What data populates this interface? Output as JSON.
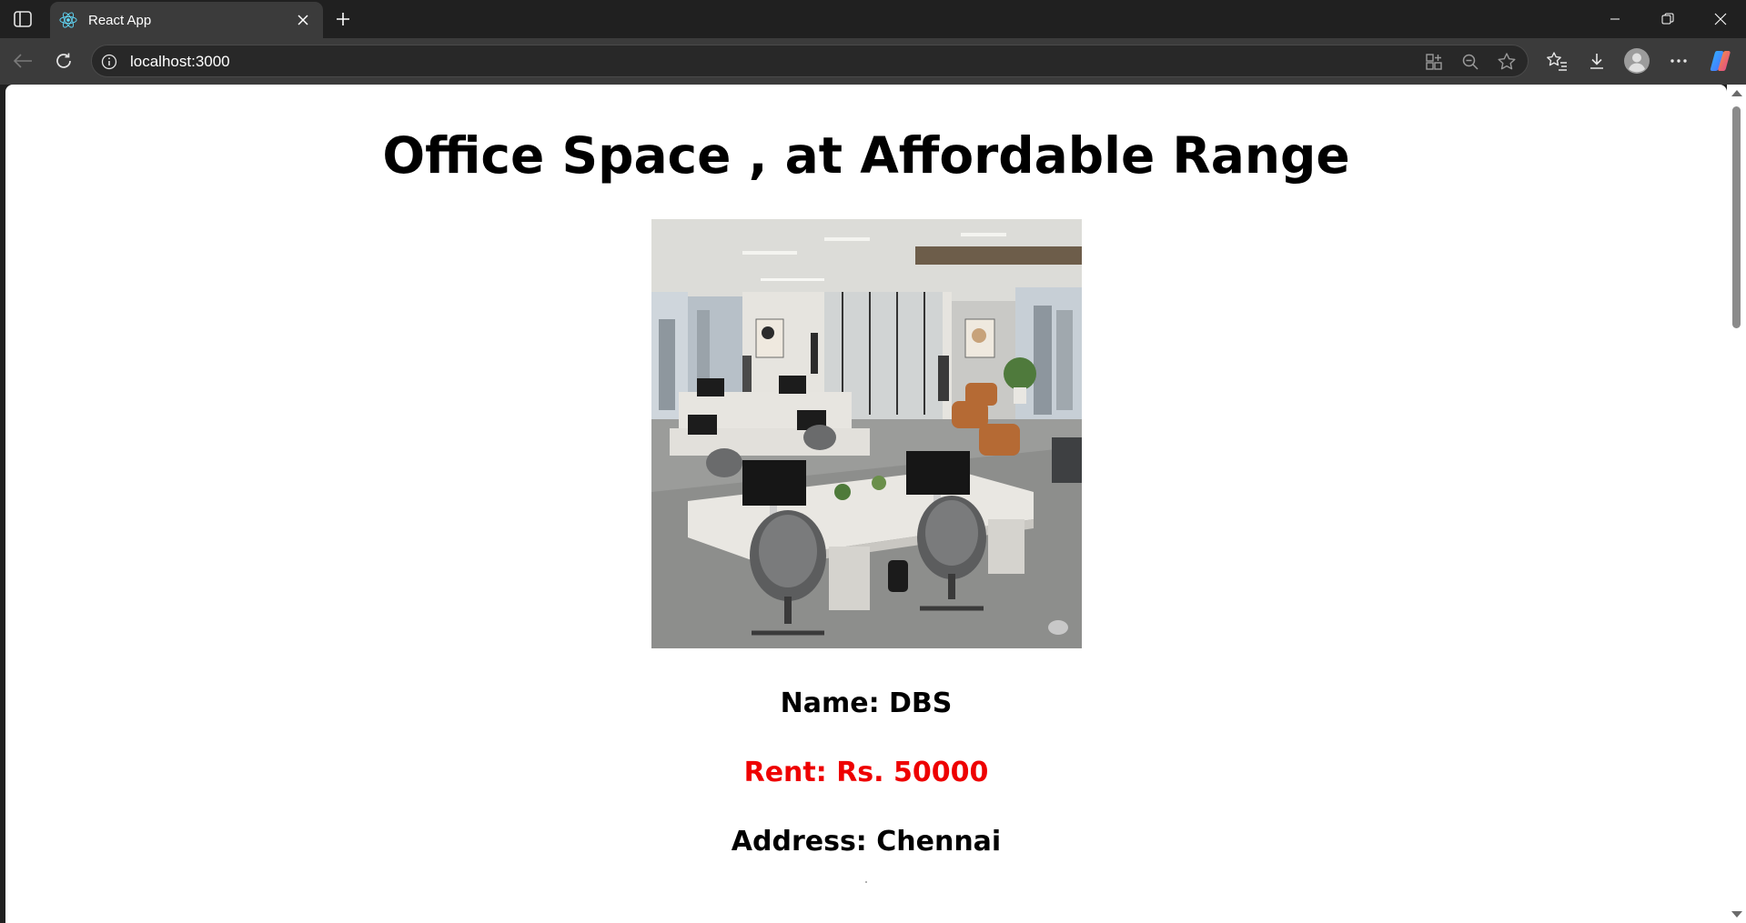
{
  "browser": {
    "tab": {
      "title": "React App",
      "favicon": "react-logo-icon"
    },
    "address_bar": {
      "url": "localhost:3000"
    },
    "window_controls": [
      "minimize",
      "restore",
      "close"
    ]
  },
  "page": {
    "heading": "Office Space , at Affordable Range",
    "image": {
      "description_icon": "office-photo"
    },
    "name_line": "Name: DBS",
    "rent_line": "Rent: Rs. 50000",
    "address_line": "Address: Chennai"
  },
  "colors": {
    "rent_text": "#ee0000",
    "chrome_bg": "#202020",
    "toolbar_bg": "#3b3b3b"
  }
}
